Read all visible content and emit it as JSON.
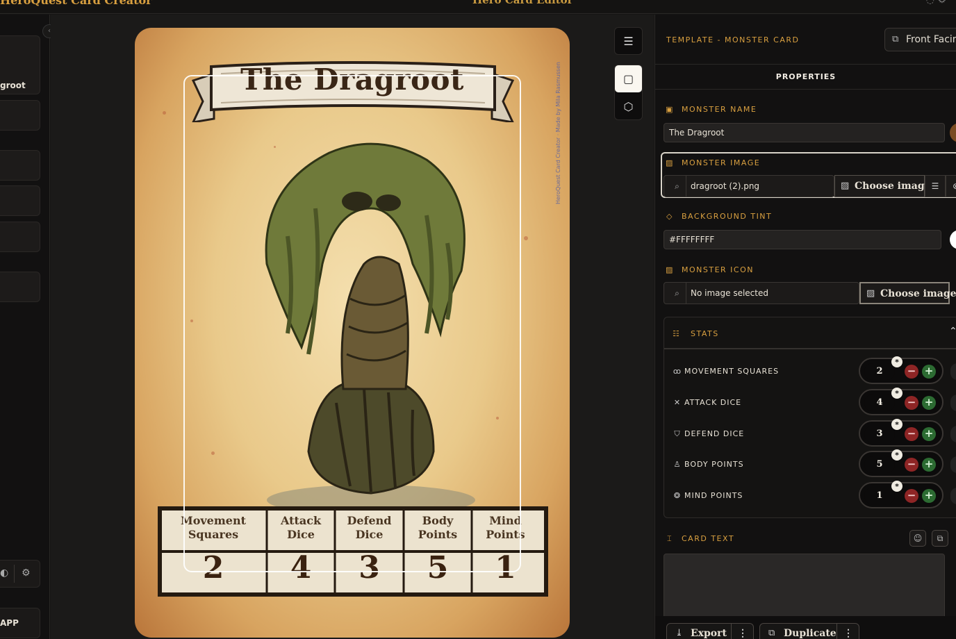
{
  "topbar": {
    "brand": "HeroQuest Card Creator",
    "center_title": "Hero Card Editor"
  },
  "sidebar": {
    "selected_card_label": "groot",
    "app_label": "APP"
  },
  "card": {
    "title": "The Dragroot",
    "credit": "HeroQuest Card Creator · Made by Mila Rasmussen",
    "stats": [
      {
        "header_line1": "Movement",
        "header_line2": "Squares",
        "value": "2"
      },
      {
        "header_line1": "Attack",
        "header_line2": "Dice",
        "value": "4"
      },
      {
        "header_line1": "Defend",
        "header_line2": "Dice",
        "value": "3"
      },
      {
        "header_line1": "Body",
        "header_line2": "Points",
        "value": "5"
      },
      {
        "header_line1": "Mind",
        "header_line2": "Points",
        "value": "1"
      }
    ]
  },
  "panel": {
    "template_label": "TEMPLATE - MONSTER CARD",
    "front_facing_label": "Front Facing",
    "properties_title": "PROPERTIES",
    "monster_name": {
      "label": "MONSTER NAME",
      "value": "The Dragroot"
    },
    "monster_image": {
      "label": "MONSTER IMAGE",
      "value": "dragroot (2).png",
      "choose_label": "Choose image"
    },
    "background_tint": {
      "label": "BACKGROUND TINT",
      "value": "#FFFFFFFF"
    },
    "monster_icon": {
      "label": "MONSTER ICON",
      "value": "No image selected",
      "choose_label": "Choose image"
    },
    "stats": {
      "label": "STATS",
      "rows": [
        {
          "name": "MOVEMENT SQUARES",
          "icon": "footprints-icon",
          "value": "2"
        },
        {
          "name": "ATTACK DICE",
          "icon": "crossed-swords-icon",
          "value": "4"
        },
        {
          "name": "DEFEND DICE",
          "icon": "shield-icon",
          "value": "3"
        },
        {
          "name": "BODY POINTS",
          "icon": "person-icon",
          "value": "5"
        },
        {
          "name": "MIND POINTS",
          "icon": "brain-icon",
          "value": "1"
        }
      ]
    },
    "card_text": {
      "label": "CARD TEXT",
      "value": ""
    },
    "export_label": "Export",
    "duplicate_label": "Duplicate"
  },
  "colors": {
    "accent": "#d9a040",
    "minus": "#8e2525",
    "plus": "#2c6b32",
    "panel_bg": "#121111"
  }
}
